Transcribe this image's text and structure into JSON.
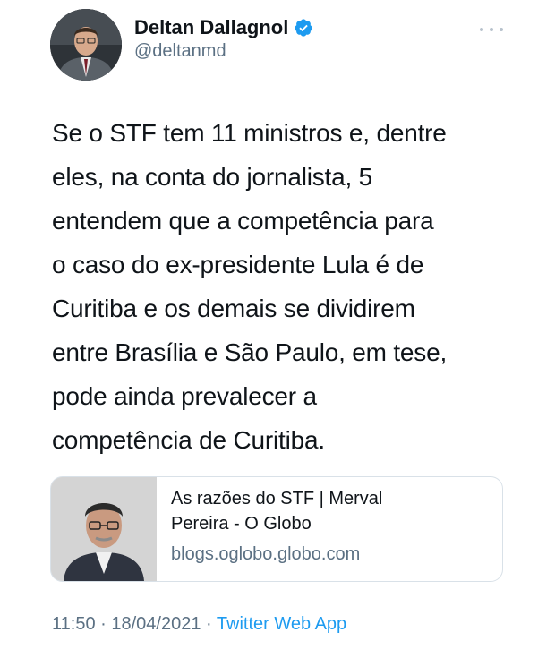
{
  "author": {
    "display_name": "Deltan Dallagnol",
    "handle": "@deltanmd",
    "verified": true,
    "avatar_icon": "profile-photo",
    "verified_icon": "verified-badge-icon"
  },
  "tweet": {
    "lines": [
      "Se o STF tem 11 ministros e, dentre",
      "eles, na conta do jornalista, 5",
      "entendem que a competência para",
      "o caso do ex-presidente Lula é de",
      "Curitiba e os demais se dividirem",
      "entre Brasília e São Paulo, em tese,",
      "pode ainda prevalecer a",
      "competência de Curitiba."
    ]
  },
  "card": {
    "title_line1": "As razões do STF | Merval",
    "title_line2": "Pereira - O Globo",
    "domain": "blogs.oglobo.globo.com",
    "thumbnail_icon": "article-thumbnail"
  },
  "meta": {
    "time": "11:50",
    "separator": "·",
    "date": "18/04/2021",
    "source": "Twitter Web App"
  },
  "colors": {
    "text": "#0f1419",
    "secondary": "#5b7083",
    "accent": "#1d9bf0",
    "border": "#d9e1e8"
  }
}
